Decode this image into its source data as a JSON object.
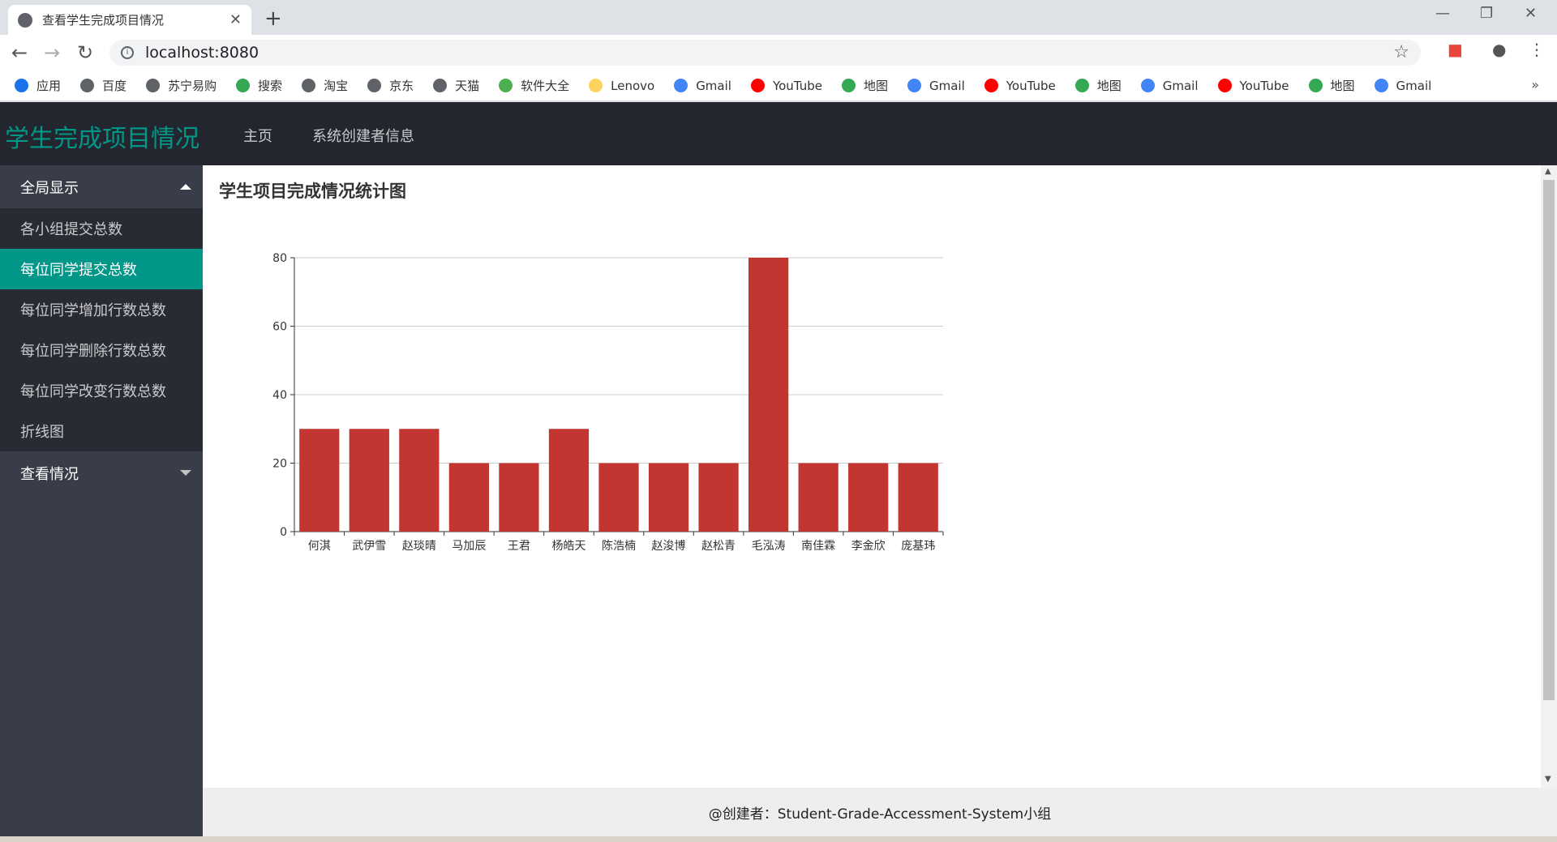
{
  "browser": {
    "tab_title": "查看学生完成项目情况",
    "url": "localhost:8080",
    "bookmarks": [
      {
        "label": "应用",
        "color": "#1a73e8"
      },
      {
        "label": "百度",
        "color": "#5f6368"
      },
      {
        "label": "苏宁易购",
        "color": "#5f6368"
      },
      {
        "label": "搜索",
        "color": "#34a853"
      },
      {
        "label": "淘宝",
        "color": "#5f6368"
      },
      {
        "label": "京东",
        "color": "#5f6368"
      },
      {
        "label": "天猫",
        "color": "#5f6368"
      },
      {
        "label": "软件大全",
        "color": "#4caf50"
      },
      {
        "label": "Lenovo",
        "color": "#fbd35e"
      },
      {
        "label": "Gmail",
        "color": "#4285f4"
      },
      {
        "label": "YouTube",
        "color": "#ff0000"
      },
      {
        "label": "地图",
        "color": "#34a853"
      },
      {
        "label": "Gmail",
        "color": "#4285f4"
      },
      {
        "label": "YouTube",
        "color": "#ff0000"
      },
      {
        "label": "地图",
        "color": "#34a853"
      },
      {
        "label": "Gmail",
        "color": "#4285f4"
      },
      {
        "label": "YouTube",
        "color": "#ff0000"
      },
      {
        "label": "地图",
        "color": "#34a853"
      },
      {
        "label": "Gmail",
        "color": "#4285f4"
      }
    ],
    "more": "»"
  },
  "app": {
    "logo": "学生完成项目情况",
    "nav": [
      "主页",
      "系统创建者信息"
    ],
    "accent": "#009688"
  },
  "sidebar": {
    "group1": "全局显示",
    "items": [
      "各小组提交总数",
      "每位同学提交总数",
      "每位同学增加行数总数",
      "每位同学删除行数总数",
      "每位同学改变行数总数",
      "折线图"
    ],
    "active_index": 1,
    "group2": "查看情况"
  },
  "main": {
    "title": "学生项目完成情况统计图"
  },
  "chart_data": {
    "type": "bar",
    "categories": [
      "何淇",
      "武伊雪",
      "赵琰晴",
      "马加辰",
      "王君",
      "杨皓天",
      "陈浩楠",
      "赵浚博",
      "赵松青",
      "毛泓涛",
      "南佳霖",
      "李金欣",
      "庞基玮"
    ],
    "values": [
      30,
      30,
      30,
      20,
      20,
      30,
      20,
      20,
      20,
      80,
      20,
      20,
      20
    ],
    "ylim": [
      0,
      80
    ],
    "yticks": [
      0,
      20,
      40,
      60,
      80
    ],
    "bar_color": "#c23531",
    "grid": true
  },
  "footer": {
    "text": "@创建者：Student-Grade-Accessment-System小组"
  }
}
